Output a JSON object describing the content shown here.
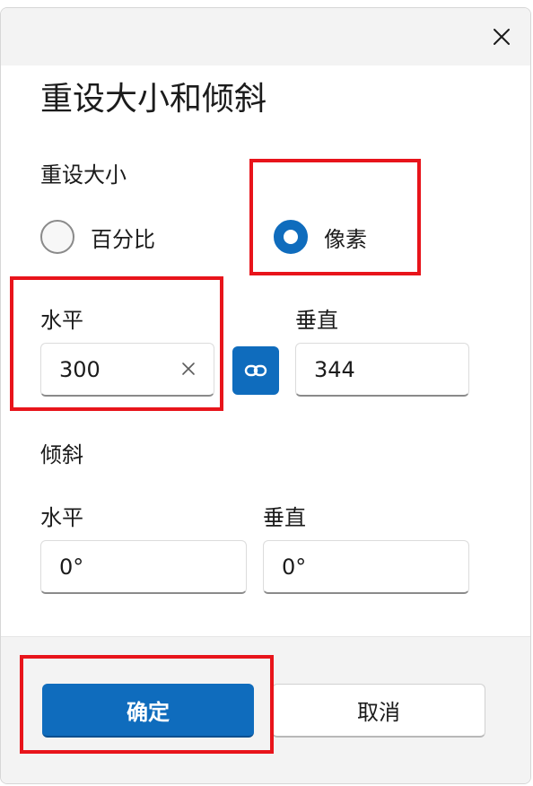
{
  "dialog": {
    "title": "重设大小和倾斜",
    "close_icon": "close-icon"
  },
  "resize": {
    "label": "重设大小",
    "options": [
      {
        "label": "百分比",
        "checked": false
      },
      {
        "label": "像素",
        "checked": true
      }
    ],
    "horizontal_label": "水平",
    "vertical_label": "垂直",
    "horizontal_value": "300",
    "vertical_value": "344",
    "link_icon": "link-icon",
    "clear_icon": "clear-icon"
  },
  "skew": {
    "label": "倾斜",
    "horizontal_label": "水平",
    "vertical_label": "垂直",
    "horizontal_value": "0°",
    "vertical_value": "0°"
  },
  "footer": {
    "ok_label": "确定",
    "cancel_label": "取消"
  },
  "colors": {
    "accent": "#0f6cbd",
    "highlight": "#e8141b",
    "titlebar": "#f3f3f3"
  }
}
